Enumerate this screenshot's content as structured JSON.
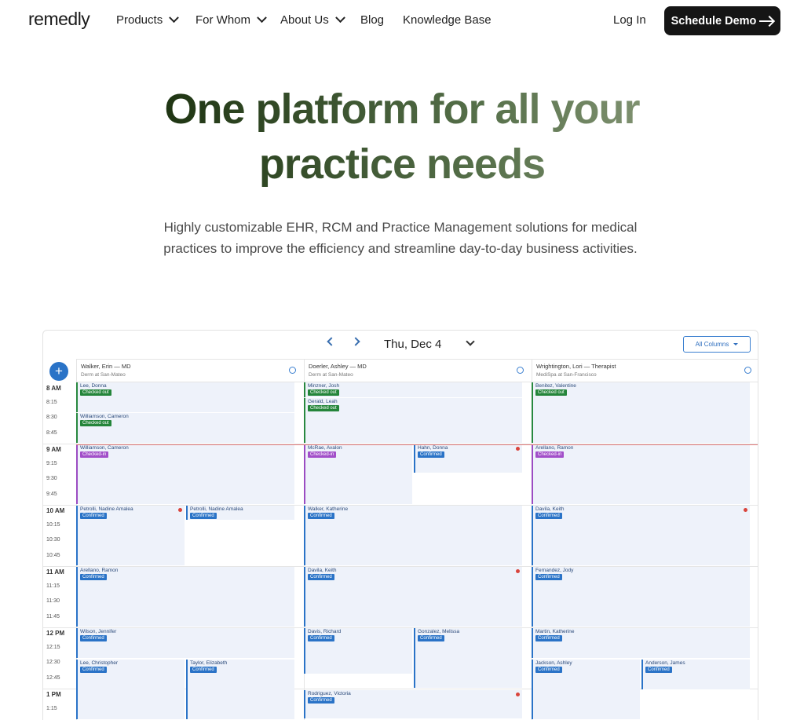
{
  "nav": {
    "logo": "remedly",
    "items": [
      {
        "label": "Products",
        "dropdown": true
      },
      {
        "label": "For Whom",
        "dropdown": true
      },
      {
        "label": "About Us",
        "dropdown": true
      },
      {
        "label": "Blog",
        "dropdown": false
      },
      {
        "label": "Knowledge Base",
        "dropdown": false
      }
    ],
    "login": "Log In",
    "cta": "Schedule Demo"
  },
  "hero": {
    "title_line1": "One platform for all your",
    "title_line2": "practice needs",
    "subtitle_line1": "Highly customizable EHR, RCM and Practice Management solutions for medical",
    "subtitle_line2": "practices to improve the efficiency and streamline day-to-day business activities."
  },
  "calendar": {
    "date": "Thu, Dec 4",
    "filter": "All Columns",
    "add_symbol": "+",
    "columns": [
      {
        "name": "Walker, Erin — MD",
        "location": "Derm at San-Mateo"
      },
      {
        "name": "Doerler, Ashley — MD",
        "location": "Derm at San-Mateo"
      },
      {
        "name": "Wrightington, Lori — Therapist",
        "location": "MediSpa at San-Francisco"
      }
    ],
    "times": [
      "8 AM",
      "8:15",
      "8:30",
      "8:45",
      "9 AM",
      "9:15",
      "9:30",
      "9:45",
      "10 AM",
      "10:15",
      "10:30",
      "10:45",
      "11 AM",
      "11:15",
      "11:30",
      "11:45",
      "12 PM",
      "12:15",
      "12:30",
      "12:45",
      "1 PM",
      "1:15"
    ],
    "appointments": [
      {
        "name": "Lee, Donna",
        "status": "Checked out",
        "color": "green"
      },
      {
        "name": "Williamson, Cameron",
        "status": "Checked out",
        "color": "green"
      },
      {
        "name": "Williamson, Cameron",
        "status": "Checked-in",
        "color": "purple"
      },
      {
        "name": "Petrolli, Nadine Amalea",
        "status": "Confirmed",
        "color": "blue"
      },
      {
        "name": "Petrolli, Nadine Amalea",
        "status": "Confirmed",
        "color": "blue"
      },
      {
        "name": "Arellano, Ramon",
        "status": "Confirmed",
        "color": "blue"
      },
      {
        "name": "Wilson, Jennifer",
        "status": "Confirmed",
        "color": "blue"
      },
      {
        "name": "Lee, Christopher",
        "status": "Confirmed",
        "color": "blue"
      },
      {
        "name": "Taylor, Elizabeth",
        "status": "Confirmed",
        "color": "blue"
      },
      {
        "name": "Minzner, Josh",
        "status": "Checked out",
        "color": "green"
      },
      {
        "name": "Gerald, Leah",
        "status": "Checked out",
        "color": "green"
      },
      {
        "name": "McRae, Avalon",
        "status": "Checked-in",
        "color": "purple"
      },
      {
        "name": "Hahn, Donna",
        "status": "Confirmed",
        "color": "blue"
      },
      {
        "name": "Walker, Katherine",
        "status": "Confirmed",
        "color": "blue"
      },
      {
        "name": "Davila, Keith",
        "status": "Confirmed",
        "color": "blue"
      },
      {
        "name": "Davis, Richard",
        "status": "Confirmed",
        "color": "blue"
      },
      {
        "name": "Gonzalez, Melissa",
        "status": "Confirmed",
        "color": "blue"
      },
      {
        "name": "Rodriguez, Victoria",
        "status": "Confirmed",
        "color": "blue"
      },
      {
        "name": "Benitez, Valentine",
        "status": "Checked out",
        "color": "green"
      },
      {
        "name": "Arellano, Ramon",
        "status": "Checked-in",
        "color": "purple"
      },
      {
        "name": "Davila, Keith",
        "status": "Confirmed",
        "color": "blue"
      },
      {
        "name": "Fernandez, Jody",
        "status": "Confirmed",
        "color": "blue"
      },
      {
        "name": "Martin, Katherine",
        "status": "Confirmed",
        "color": "blue"
      },
      {
        "name": "Jackson, Ashley",
        "status": "Confirmed",
        "color": "blue"
      },
      {
        "name": "Anderson, James",
        "status": "Confirmed",
        "color": "blue"
      }
    ]
  },
  "colors": {
    "accent": "#2a73c7",
    "checked_out": "#24853a",
    "checked_in": "#a24fc9",
    "cta_bg": "#151515"
  }
}
